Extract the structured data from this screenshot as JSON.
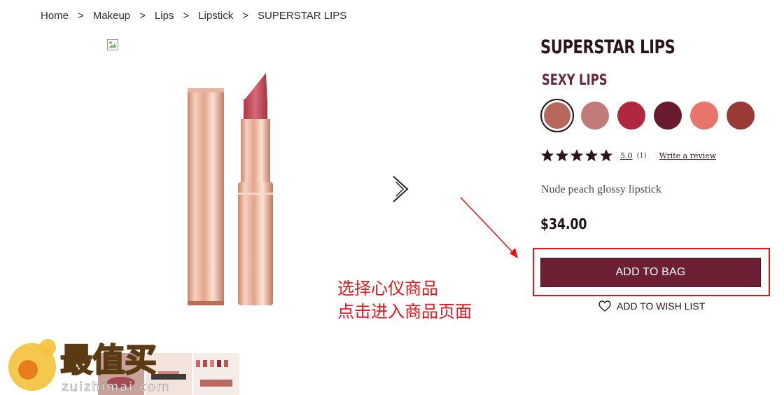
{
  "breadcrumb": {
    "items": [
      "Home",
      "Makeup",
      "Lips",
      "Lipstick"
    ],
    "separator": ">",
    "current": "SUPERSTAR LIPS"
  },
  "product": {
    "title": "SUPERSTAR LIPS",
    "shade_name": "SEXY LIPS",
    "swatches": [
      {
        "color": "#b8685a",
        "selected": true
      },
      {
        "color": "#c07a78",
        "selected": false
      },
      {
        "color": "#b0283f",
        "selected": false
      },
      {
        "color": "#6a1a2e",
        "selected": false
      },
      {
        "color": "#e8746a",
        "selected": false
      },
      {
        "color": "#9a3a34",
        "selected": false
      }
    ],
    "rating": {
      "stars": 5,
      "value": "5.0",
      "count": "(1)",
      "write_review": "Write a review"
    },
    "description": "Nude peach glossy lipstick",
    "price": "$34.00",
    "add_to_bag": "ADD TO BAG",
    "add_to_wish": "ADD TO WISH LIST"
  },
  "annotation": {
    "line1": "选择心仪商品",
    "line2": "点击进入商品页面",
    "color": "#e8141b"
  },
  "watermark": {
    "text": "最值买",
    "url": "zuizhimai.com"
  },
  "colors": {
    "brand": "#6b1f30",
    "title": "#2b1518",
    "annotation_red": "#e8141b"
  }
}
